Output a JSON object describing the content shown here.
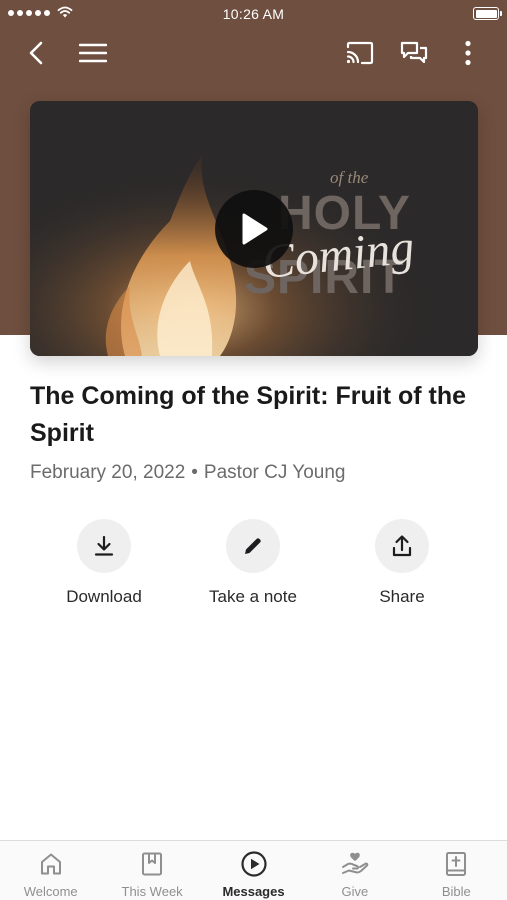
{
  "status_bar": {
    "time": "10:26 AM"
  },
  "video": {
    "art_words": {
      "of_the": "of the",
      "holy": "HOLY",
      "coming": "Coming",
      "spirit": "SPIRIT"
    }
  },
  "sermon": {
    "title": "The Coming of the Spirit: Fruit of the Spirit",
    "date": "February 20, 2022",
    "separator": "•",
    "speaker": "Pastor CJ Young"
  },
  "actions": [
    {
      "label": "Download",
      "icon": "download-icon"
    },
    {
      "label": "Take a note",
      "icon": "pencil-icon"
    },
    {
      "label": "Share",
      "icon": "share-icon"
    }
  ],
  "tabs": [
    {
      "label": "Welcome",
      "icon": "home-icon",
      "active": false
    },
    {
      "label": "This Week",
      "icon": "bookmark-icon",
      "active": false
    },
    {
      "label": "Messages",
      "icon": "play-circle-icon",
      "active": true
    },
    {
      "label": "Give",
      "icon": "give-hand-icon",
      "active": false
    },
    {
      "label": "Bible",
      "icon": "bible-icon",
      "active": false
    }
  ],
  "colors": {
    "header_brown": "#6f4f3f",
    "active_tab": "#2b2b2b",
    "inactive_tab": "#8f8f8f"
  }
}
